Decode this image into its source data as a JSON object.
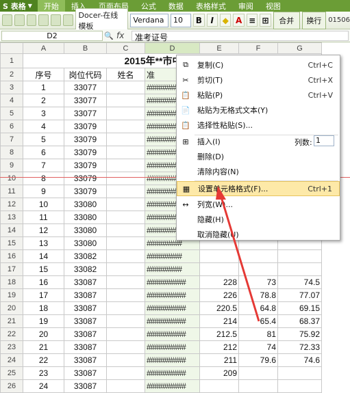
{
  "app": {
    "name": "S 表格",
    "menu": [
      "开始",
      "插入",
      "页面布局",
      "公式",
      "数据",
      "表格样式",
      "审阅",
      "视图"
    ],
    "active_menu": "开始"
  },
  "toolbar": {
    "docer_label": "Docer-在线模板",
    "font_name": "Verdana",
    "font_size": "10",
    "merge_label": "合并",
    "wrap_label": "换行",
    "file_fragment": "01506"
  },
  "formula_bar": {
    "cell_ref": "D2",
    "fx": "fx",
    "content": "准考证号"
  },
  "sheet": {
    "columns": [
      "A",
      "B",
      "C",
      "D",
      "E",
      "F",
      "G"
    ],
    "title": "2015年**市中小学、幼",
    "headers": [
      "序号",
      "岗位代码",
      "姓名",
      "准"
    ],
    "rows": [
      {
        "n": "1",
        "a": "",
        "b": "",
        "c": "",
        "d": "",
        "e": "",
        "f": "",
        "g": ""
      },
      {
        "n": "2",
        "a": "序号",
        "b": "岗位代码",
        "c": "姓名",
        "d": "准",
        "e": "",
        "f": "",
        "g": ""
      },
      {
        "n": "3",
        "a": "1",
        "b": "33077",
        "c": "",
        "d": "#########",
        "e": "",
        "f": "",
        "g": ""
      },
      {
        "n": "4",
        "a": "2",
        "b": "33077",
        "c": "",
        "d": "#########",
        "e": "",
        "f": "",
        "g": ""
      },
      {
        "n": "5",
        "a": "3",
        "b": "33077",
        "c": "",
        "d": "#########",
        "e": "",
        "f": "",
        "g": ""
      },
      {
        "n": "6",
        "a": "4",
        "b": "33079",
        "c": "",
        "d": "#########",
        "e": "",
        "f": "",
        "g": ""
      },
      {
        "n": "7",
        "a": "5",
        "b": "33079",
        "c": "",
        "d": "#########",
        "e": "",
        "f": "",
        "g": ""
      },
      {
        "n": "8",
        "a": "6",
        "b": "33079",
        "c": "",
        "d": "#########",
        "e": "",
        "f": "",
        "g": ""
      },
      {
        "n": "9",
        "a": "7",
        "b": "33079",
        "c": "",
        "d": "#########",
        "e": "",
        "f": "",
        "g": ""
      },
      {
        "n": "10",
        "a": "8",
        "b": "33079",
        "c": "",
        "d": "#########",
        "e": "",
        "f": "",
        "g": ""
      },
      {
        "n": "11",
        "a": "9",
        "b": "33079",
        "c": "",
        "d": "#########",
        "e": "",
        "f": "",
        "g": ""
      },
      {
        "n": "12",
        "a": "10",
        "b": "33080",
        "c": "",
        "d": "#########",
        "e": "",
        "f": "",
        "g": ""
      },
      {
        "n": "13",
        "a": "11",
        "b": "33080",
        "c": "",
        "d": "#########",
        "e": "",
        "f": "",
        "g": ""
      },
      {
        "n": "14",
        "a": "12",
        "b": "33080",
        "c": "",
        "d": "#########",
        "e": "",
        "f": "",
        "g": ""
      },
      {
        "n": "15",
        "a": "13",
        "b": "33080",
        "c": "",
        "d": "#########",
        "e": "",
        "f": "",
        "g": ""
      },
      {
        "n": "16",
        "a": "14",
        "b": "33082",
        "c": "",
        "d": "#########",
        "e": "",
        "f": "",
        "g": ""
      },
      {
        "n": "17",
        "a": "15",
        "b": "33082",
        "c": "",
        "d": "#########",
        "e": "",
        "f": "",
        "g": ""
      },
      {
        "n": "18",
        "a": "16",
        "b": "33087",
        "c": "",
        "d": "##########",
        "e": "228",
        "f": "73",
        "g": "74.5"
      },
      {
        "n": "19",
        "a": "17",
        "b": "33087",
        "c": "",
        "d": "##########",
        "e": "226",
        "f": "78.8",
        "g": "77.07"
      },
      {
        "n": "20",
        "a": "18",
        "b": "33087",
        "c": "",
        "d": "##########",
        "e": "220.5",
        "f": "64.8",
        "g": "69.15"
      },
      {
        "n": "21",
        "a": "19",
        "b": "33087",
        "c": "",
        "d": "##########",
        "e": "214",
        "f": "65.4",
        "g": "68.37"
      },
      {
        "n": "22",
        "a": "20",
        "b": "33087",
        "c": "",
        "d": "##########",
        "e": "212.5",
        "f": "81",
        "g": "75.92"
      },
      {
        "n": "23",
        "a": "21",
        "b": "33087",
        "c": "",
        "d": "##########",
        "e": "212",
        "f": "74",
        "g": "72.33"
      },
      {
        "n": "24",
        "a": "22",
        "b": "33087",
        "c": "",
        "d": "##########",
        "e": "211",
        "f": "79.6",
        "g": "74.6"
      },
      {
        "n": "25",
        "a": "23",
        "b": "33087",
        "c": "",
        "d": "##########",
        "e": "209",
        "f": "",
        "g": ""
      },
      {
        "n": "26",
        "a": "24",
        "b": "33087",
        "c": "",
        "d": "##########",
        "e": "",
        "f": "",
        "g": ""
      }
    ]
  },
  "context_menu": {
    "items": [
      {
        "icon": "copy-icon",
        "label": "复制(C)",
        "shortcut": "Ctrl+C"
      },
      {
        "icon": "cut-icon",
        "label": "剪切(T)",
        "shortcut": "Ctrl+X"
      },
      {
        "icon": "paste-icon",
        "label": "粘贴(P)",
        "shortcut": "Ctrl+V"
      },
      {
        "icon": "paste-text-icon",
        "label": "粘贴为无格式文本(Y)",
        "shortcut": ""
      },
      {
        "icon": "paste-special-icon",
        "label": "选择性粘贴(S)...",
        "shortcut": ""
      },
      {
        "icon": "insert-icon",
        "label": "插入(I)",
        "shortcut": ""
      },
      {
        "icon": "",
        "label": "删除(D)",
        "shortcut": ""
      },
      {
        "icon": "",
        "label": "清除内容(N)",
        "shortcut": ""
      },
      {
        "icon": "format-cells-icon",
        "label": "设置单元格格式(F)...",
        "shortcut": "Ctrl+1"
      },
      {
        "icon": "column-width-icon",
        "label": "列宽(W)...",
        "shortcut": ""
      },
      {
        "icon": "",
        "label": "隐藏(H)",
        "shortcut": ""
      },
      {
        "icon": "",
        "label": "取消隐藏(U)",
        "shortcut": ""
      }
    ],
    "column_count_label": "列数:",
    "column_count_value": "1"
  },
  "colors": {
    "ribbon_green": "#6b9d36",
    "highlight": "#fde9a8",
    "arrow_red": "#e53935"
  }
}
